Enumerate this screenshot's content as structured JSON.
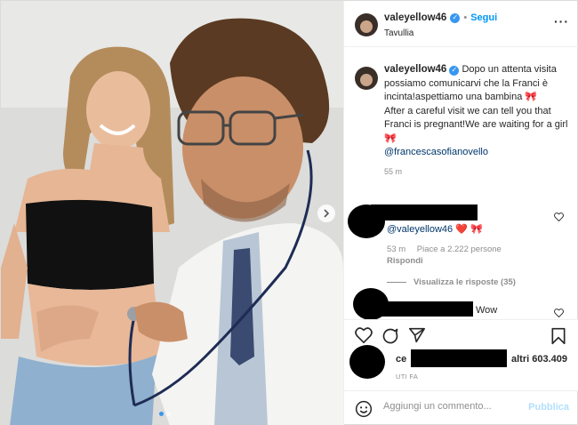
{
  "post": {
    "username": "valeyellow46",
    "separator": "•",
    "follow_label": "Segui",
    "location": "Tavullia",
    "more_icon": "more-horizontal-icon"
  },
  "caption": {
    "username": "valeyellow46",
    "text_it": "Dopo un attenta visita possiamo comunicarvi che la Franci è incinta!aspettiamo una bambina 🎀",
    "text_en": "After a careful visit we can tell you that Franci is pregnant!We are waiting for a girl 🎀",
    "mention": "@francescasofianovello",
    "time": "55 m"
  },
  "comments": [
    {
      "text": "@valeyellow46 ❤️ 🎀",
      "time": "53 m",
      "likes": "Piace a 2.222 persone",
      "reply_label": "Rispondi",
      "view_replies": "Visualizza le risposte (35)"
    },
    {
      "text": "Wow"
    }
  ],
  "actions": {
    "likes_prefix": "ce",
    "likes_suffix": "altri 603.409",
    "time_ago": "UTI FA"
  },
  "add_comment": {
    "placeholder": "Aggiungi un commento...",
    "publish_label": "Pubblica"
  },
  "colors": {
    "accent": "#0095f6",
    "verified": "#3897f0",
    "publish_disabled": "#b2dffc"
  }
}
